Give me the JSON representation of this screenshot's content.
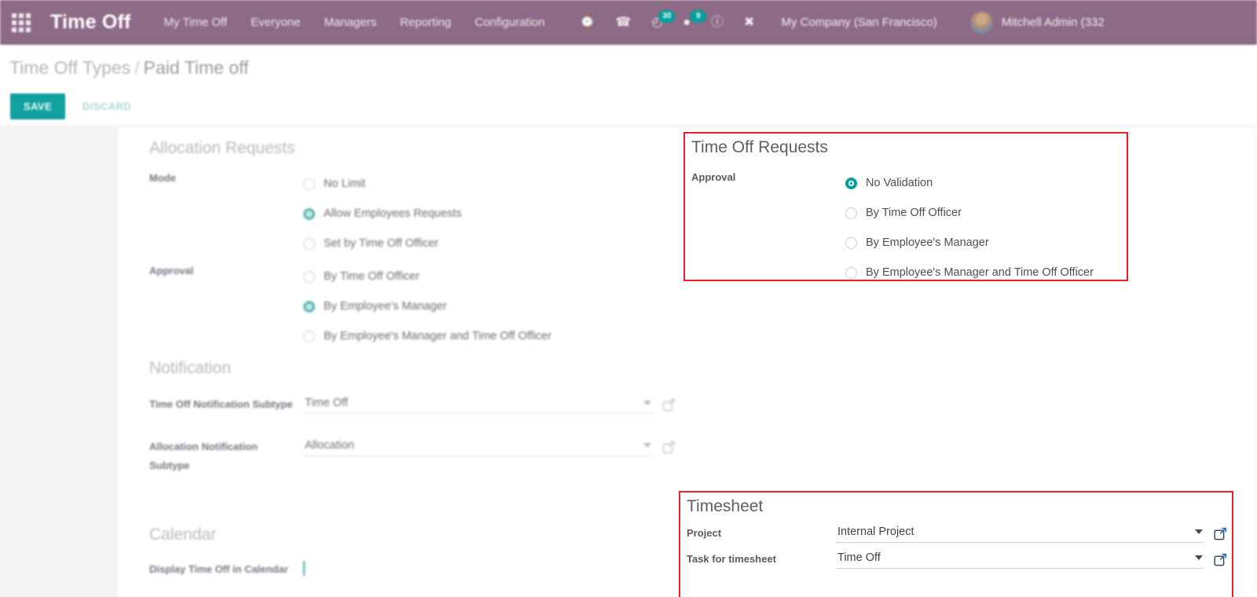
{
  "navbar": {
    "apps_icon": "apps-grid-icon",
    "brand": "Time Off",
    "menu": [
      {
        "label": "My Time Off"
      },
      {
        "label": "Everyone"
      },
      {
        "label": "Managers"
      },
      {
        "label": "Reporting"
      },
      {
        "label": "Configuration"
      }
    ],
    "systray": [
      {
        "name": "activities-icon",
        "glyph": "⌚",
        "badge": ""
      },
      {
        "name": "phone-icon",
        "glyph": "☎",
        "badge": ""
      },
      {
        "name": "clock-activity-icon",
        "glyph": "◴",
        "badge": "30"
      },
      {
        "name": "messages-icon",
        "glyph": "●",
        "badge": "9"
      },
      {
        "name": "info-icon",
        "glyph": "ⓘ",
        "badge": ""
      },
      {
        "name": "debug-icon",
        "glyph": "✖",
        "badge": ""
      }
    ],
    "company": "My Company (San Francisco)",
    "username": "Mitchell Admin (332"
  },
  "control_panel": {
    "breadcrumb_root": "Time Off Types",
    "breadcrumb_sep": "/",
    "breadcrumb_current": "Paid Time off",
    "save_label": "SAVE",
    "discard_label": "DISCARD"
  },
  "allocation_requests": {
    "title": "Allocation Requests",
    "mode_label": "Mode",
    "mode_options": [
      {
        "label": "No Limit",
        "selected": false
      },
      {
        "label": "Allow Employees Requests",
        "selected": true
      },
      {
        "label": "Set by Time Off Officer",
        "selected": false
      }
    ],
    "approval_label": "Approval",
    "approval_options": [
      {
        "label": "By Time Off Officer",
        "selected": false
      },
      {
        "label": "By Employee's Manager",
        "selected": true
      },
      {
        "label": "By Employee's Manager and Time Off Officer",
        "selected": false
      }
    ]
  },
  "notification": {
    "title": "Notification",
    "fields": [
      {
        "label": "Time Off Notification Subtype",
        "value": "Time Off"
      },
      {
        "label": "Allocation Notification Subtype",
        "value": "Allocation"
      }
    ]
  },
  "calendar": {
    "title": "Calendar",
    "display_label": "Display Time Off in Calendar",
    "display_checked": true
  },
  "time_off_requests": {
    "title": "Time Off Requests",
    "approval_label": "Approval",
    "approval_options": [
      {
        "label": "No Validation",
        "selected": true
      },
      {
        "label": "By Time Off Officer",
        "selected": false
      },
      {
        "label": "By Employee's Manager",
        "selected": false
      },
      {
        "label": "By Employee's Manager and Time Off Officer",
        "selected": false
      }
    ]
  },
  "timesheet": {
    "title": "Timesheet",
    "project_label": "Project",
    "project_value": "Internal Project",
    "task_label": "Task for timesheet",
    "task_value": "Time Off"
  },
  "colors": {
    "navbar": "#8d6a85",
    "accent_teal": "#00a09d",
    "annotation_red": "#ee1c25",
    "link_icon_blue": "#2f5c8f"
  }
}
